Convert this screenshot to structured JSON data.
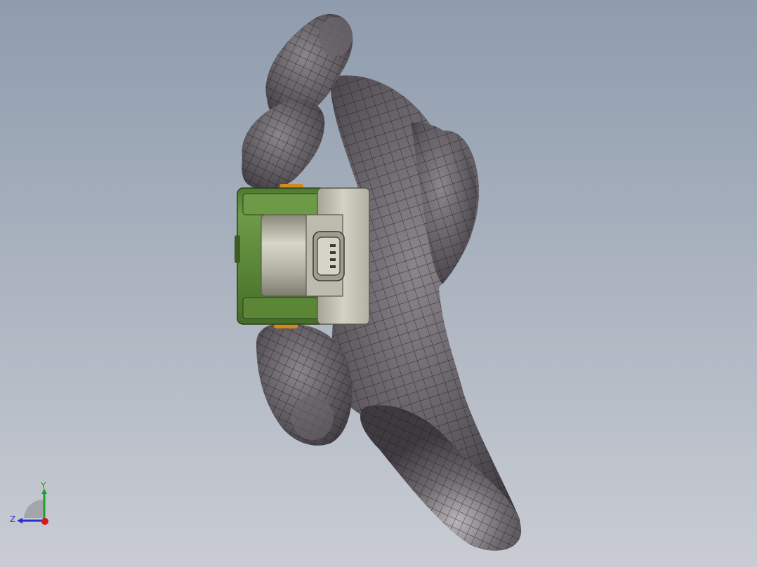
{
  "viewport": {
    "background_top": "#8e9cad",
    "background_bottom": "#c9ccd3",
    "model_color": "#5f5a60",
    "mesh_color": "#1e1c20",
    "case_green": "#5d8a3a",
    "case_grey": "#c8c6b8",
    "accent_orange": "#d28a1c"
  },
  "triad": {
    "y_label": "Y",
    "z_label": "Z",
    "y_color": "#1aa329",
    "z_color": "#2432c8",
    "x_color": "#d11a1a"
  }
}
